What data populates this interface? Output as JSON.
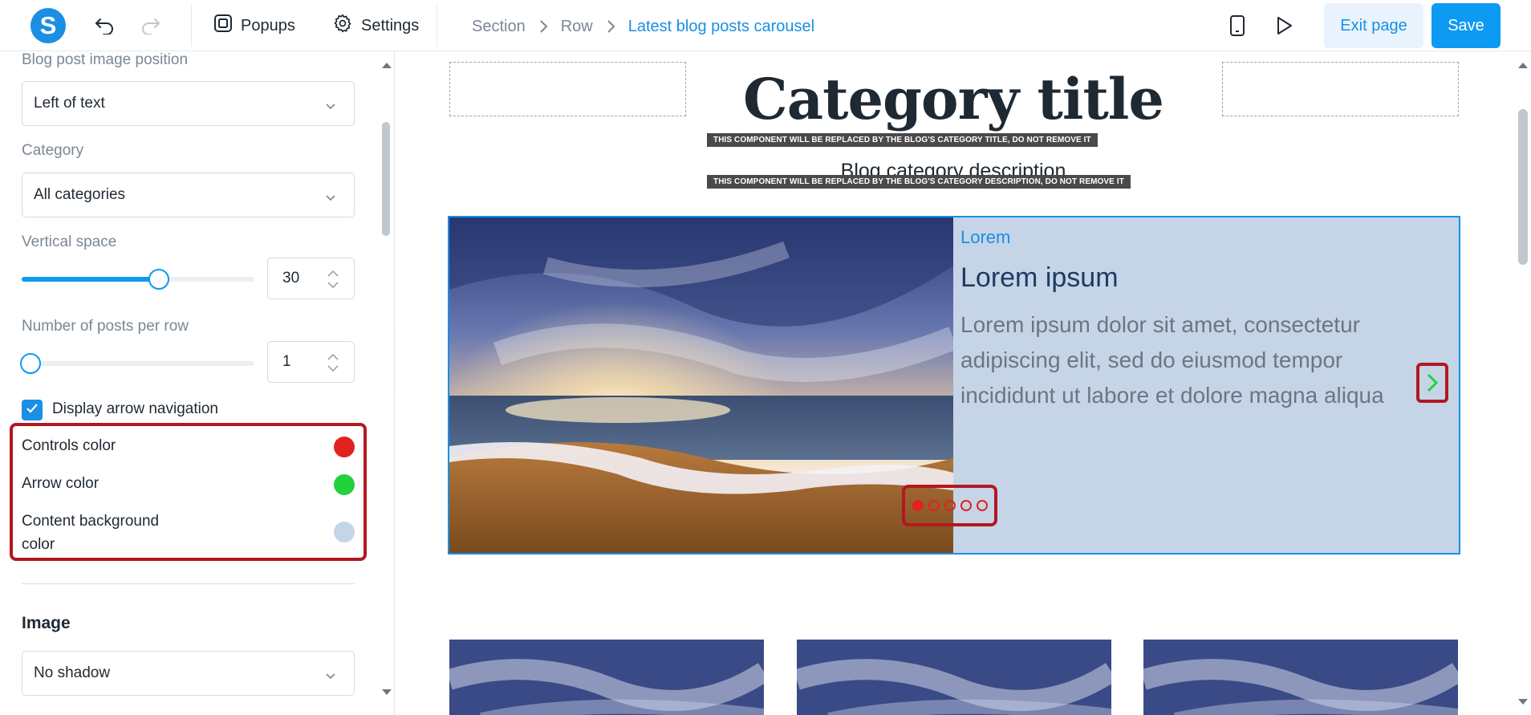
{
  "toolbar": {
    "logo_letter": "S",
    "popups_label": "Popups",
    "settings_label": "Settings",
    "exit_label": "Exit page",
    "save_label": "Save"
  },
  "breadcrumb": [
    "Section",
    "Row",
    "Latest blog posts carousel"
  ],
  "panel": {
    "image_position": {
      "label": "Blog post image position",
      "value": "Left of text"
    },
    "category": {
      "label": "Category",
      "value": "All categories"
    },
    "vertical_space": {
      "label": "Vertical space",
      "value": "30",
      "slider_fraction": 0.59
    },
    "posts_per_row": {
      "label": "Number of posts per row",
      "value": "1",
      "slider_fraction": 0.0
    },
    "arrow_nav": {
      "label": "Display arrow navigation",
      "checked": true
    },
    "colors": [
      {
        "label": "Controls color",
        "color": "#e0231e"
      },
      {
        "label": "Arrow color",
        "color": "#22d13b"
      },
      {
        "label": "Content background color",
        "color": "#c5d5e7"
      }
    ],
    "image_section": {
      "title": "Image",
      "shadow_value": "No shadow"
    }
  },
  "canvas": {
    "category_title": "Category title",
    "title_notice": "THIS COMPONENT WILL BE REPLACED BY THE BLOG'S CATEGORY TITLE, DO NOT REMOVE IT",
    "category_description": "Blog category description",
    "description_notice": "THIS COMPONENT WILL BE REPLACED BY THE BLOG'S CATEGORY DESCRIPTION, DO NOT REMOVE IT",
    "post": {
      "category": "Lorem",
      "title": "Lorem ipsum",
      "excerpt": "Lorem ipsum dolor sit amet, consectetur adipiscing elit, sed do eiusmod tempor incididunt ut labore et dolore magna aliqua"
    },
    "carousel_pages": 5,
    "active_page": 1
  },
  "icons": {
    "undo": "undo-icon",
    "redo": "redo-icon",
    "popups": "popups-icon",
    "settings": "gear-icon",
    "mobile": "mobile-preview-icon",
    "play": "play-icon",
    "next": "chevron-right-icon"
  }
}
